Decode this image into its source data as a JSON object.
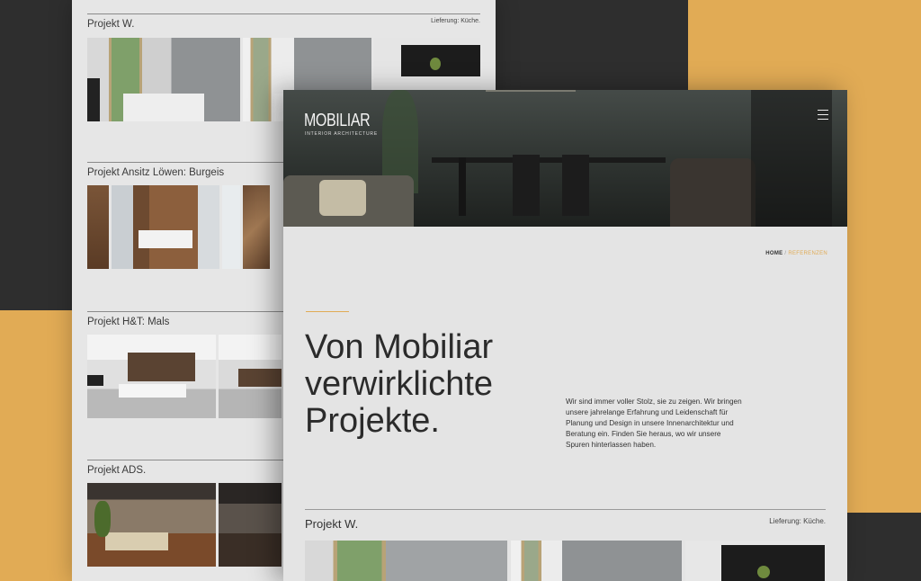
{
  "colors": {
    "accent": "#e1ab55",
    "dark": "#2e2e2e",
    "paper": "#e6e6e6"
  },
  "back_page": {
    "projects": [
      {
        "title": "Projekt W.",
        "meta": "Lieferung: Küche."
      },
      {
        "title": "Projekt Ansitz Löwen: Burgeis",
        "meta": ""
      },
      {
        "title": "Projekt H&T: Mals",
        "meta": ""
      },
      {
        "title": "Projekt ADS.",
        "meta": ""
      }
    ]
  },
  "front_page": {
    "logo": "MOBILIAR",
    "logo_sub": "INTERIOR ARCHITECTURE",
    "menu_icon": "hamburger-icon",
    "breadcrumb": {
      "home": "HOME",
      "separator": " / ",
      "current": "REFERENZEN"
    },
    "headline": "Von Mobiliar verwirklichte Projekte.",
    "intro": "Wir sind immer voller Stolz, sie zu zeigen. Wir bringen unsere jahrelange Erfahrung und Leidenschaft für Planung und Design in unsere Innenarchitektur und Beratung ein. Finden Sie heraus, wo wir unsere Spuren hinterlassen haben.",
    "project": {
      "title": "Projekt W.",
      "meta": "Lieferung: Küche."
    }
  }
}
